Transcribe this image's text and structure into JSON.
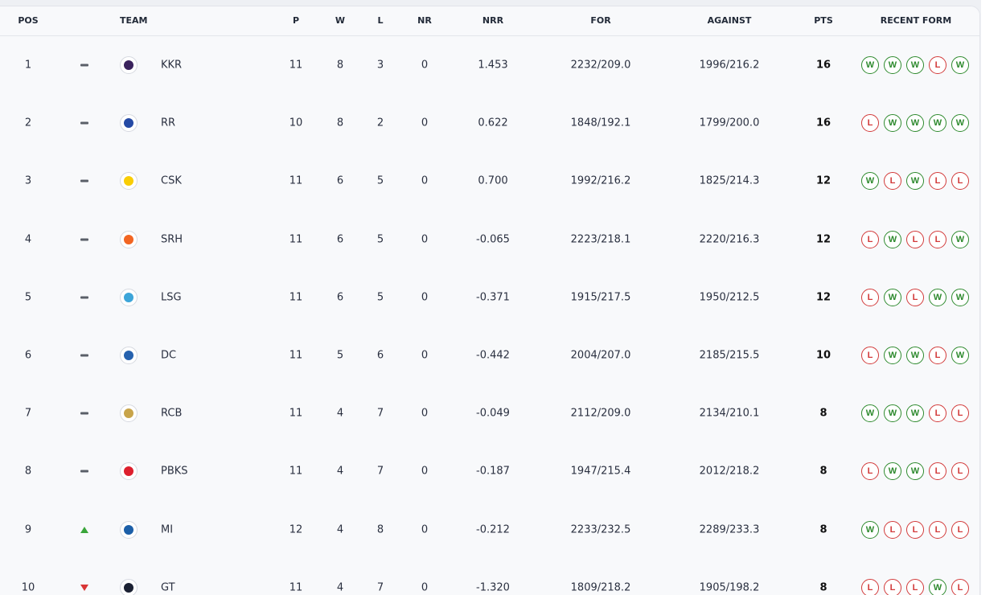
{
  "header": {
    "pos": "POS",
    "team": "TEAM",
    "p": "P",
    "w": "W",
    "l": "L",
    "nr": "NR",
    "nrr": "NRR",
    "for": "FOR",
    "against": "AGAINST",
    "pts": "PTS",
    "form": "RECENT FORM"
  },
  "colors": {
    "win": "#2e8a2e",
    "loss": "#d23a3a",
    "up": "#3aa53a",
    "down": "#d93636"
  },
  "rows": [
    {
      "pos": "1",
      "move": "same",
      "team": "KKR",
      "logo": "#3a225d",
      "p": "11",
      "w": "8",
      "l": "3",
      "nr": "0",
      "nrr": "1.453",
      "for": "2232/209.0",
      "against": "1996/216.2",
      "pts": "16",
      "form": [
        "W",
        "W",
        "W",
        "L",
        "W"
      ]
    },
    {
      "pos": "2",
      "move": "same",
      "team": "RR",
      "logo": "#254aa5",
      "p": "10",
      "w": "8",
      "l": "2",
      "nr": "0",
      "nrr": "0.622",
      "for": "1848/192.1",
      "against": "1799/200.0",
      "pts": "16",
      "form": [
        "L",
        "W",
        "W",
        "W",
        "W"
      ]
    },
    {
      "pos": "3",
      "move": "same",
      "team": "CSK",
      "logo": "#f9cd05",
      "p": "11",
      "w": "6",
      "l": "5",
      "nr": "0",
      "nrr": "0.700",
      "for": "1992/216.2",
      "against": "1825/214.3",
      "pts": "12",
      "form": [
        "W",
        "L",
        "W",
        "L",
        "L"
      ]
    },
    {
      "pos": "4",
      "move": "same",
      "team": "SRH",
      "logo": "#f26522",
      "p": "11",
      "w": "6",
      "l": "5",
      "nr": "0",
      "nrr": "-0.065",
      "for": "2223/218.1",
      "against": "2220/216.3",
      "pts": "12",
      "form": [
        "L",
        "W",
        "L",
        "L",
        "W"
      ]
    },
    {
      "pos": "5",
      "move": "same",
      "team": "LSG",
      "logo": "#3da5d9",
      "p": "11",
      "w": "6",
      "l": "5",
      "nr": "0",
      "nrr": "-0.371",
      "for": "1915/217.5",
      "against": "1950/212.5",
      "pts": "12",
      "form": [
        "L",
        "W",
        "L",
        "W",
        "W"
      ]
    },
    {
      "pos": "6",
      "move": "same",
      "team": "DC",
      "logo": "#2561ae",
      "p": "11",
      "w": "5",
      "l": "6",
      "nr": "0",
      "nrr": "-0.442",
      "for": "2004/207.0",
      "against": "2185/215.5",
      "pts": "10",
      "form": [
        "L",
        "W",
        "W",
        "L",
        "W"
      ]
    },
    {
      "pos": "7",
      "move": "same",
      "team": "RCB",
      "logo": "#c8a44a",
      "p": "11",
      "w": "4",
      "l": "7",
      "nr": "0",
      "nrr": "-0.049",
      "for": "2112/209.0",
      "against": "2134/210.1",
      "pts": "8",
      "form": [
        "W",
        "W",
        "W",
        "L",
        "L"
      ]
    },
    {
      "pos": "8",
      "move": "same",
      "team": "PBKS",
      "logo": "#dd1f2d",
      "p": "11",
      "w": "4",
      "l": "7",
      "nr": "0",
      "nrr": "-0.187",
      "for": "1947/215.4",
      "against": "2012/218.2",
      "pts": "8",
      "form": [
        "L",
        "W",
        "W",
        "L",
        "L"
      ]
    },
    {
      "pos": "9",
      "move": "up",
      "team": "MI",
      "logo": "#1c5fa8",
      "p": "12",
      "w": "4",
      "l": "8",
      "nr": "0",
      "nrr": "-0.212",
      "for": "2233/232.5",
      "against": "2289/233.3",
      "pts": "8",
      "form": [
        "W",
        "L",
        "L",
        "L",
        "L"
      ]
    },
    {
      "pos": "10",
      "move": "down",
      "team": "GT",
      "logo": "#1b2133",
      "p": "11",
      "w": "4",
      "l": "7",
      "nr": "0",
      "nrr": "-1.320",
      "for": "1809/218.2",
      "against": "1905/198.2",
      "pts": "8",
      "form": [
        "L",
        "L",
        "L",
        "W",
        "L"
      ]
    }
  ]
}
